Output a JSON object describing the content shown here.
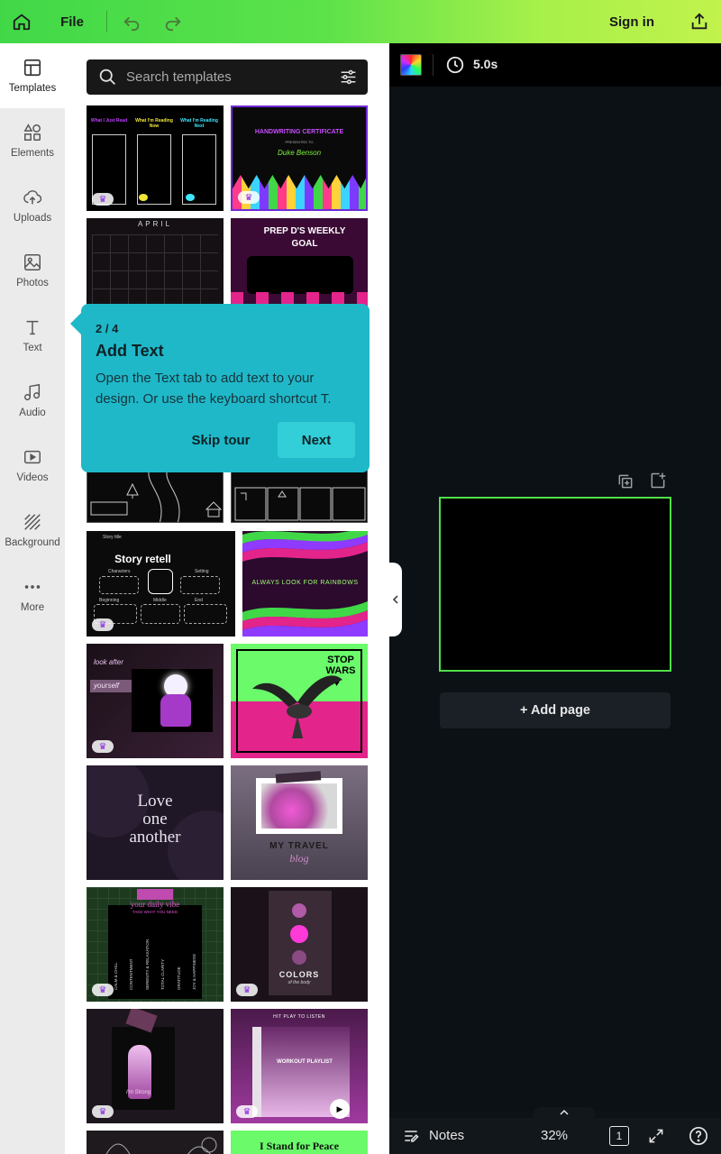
{
  "topbar": {
    "file_label": "File",
    "signin_label": "Sign in",
    "brand_gradient": [
      "#41d848",
      "#c2f24c"
    ]
  },
  "sidebar": {
    "items": [
      {
        "label": "Templates",
        "icon": "templates-icon"
      },
      {
        "label": "Elements",
        "icon": "elements-icon"
      },
      {
        "label": "Uploads",
        "icon": "uploads-icon"
      },
      {
        "label": "Photos",
        "icon": "photos-icon"
      },
      {
        "label": "Text",
        "icon": "text-icon"
      },
      {
        "label": "Audio",
        "icon": "audio-icon"
      },
      {
        "label": "Videos",
        "icon": "videos-icon"
      },
      {
        "label": "Background",
        "icon": "background-icon"
      },
      {
        "label": "More",
        "icon": "more-icon"
      }
    ]
  },
  "search": {
    "placeholder": "Search templates"
  },
  "templates": {
    "t2": {
      "title": "HANDWRITING CERTIFICATE",
      "subtitle": "PRESENTED TO",
      "name": "Duke Benson"
    },
    "t1": {
      "c1": "What I Just Read",
      "c2": "What I'm Reading Now",
      "c3": "What I'm Reading Next"
    },
    "t3": {
      "title": "APRIL"
    },
    "t4": {
      "title": "PREP D'S WEEKLY GOAL"
    },
    "t7": {
      "title": "Story retell",
      "col1": "Characters",
      "col2": "Setting",
      "col3": "Beginning",
      "col4": "Middle",
      "col5": "End",
      "col6": "Story title"
    },
    "t8": {
      "title": "ALWAYS LOOK FOR RAINBOWS"
    },
    "t9": {
      "line1": "look after",
      "line2": "yourself"
    },
    "t10": {
      "line1": "STOP",
      "line2": "WARS"
    },
    "t11": {
      "line1": "Love",
      "line2": "one",
      "line3": "another"
    },
    "t12": {
      "title": "MY TRAVEL",
      "subtitle": "blog"
    },
    "t13": {
      "title": "your daily vibe",
      "subtitle": "TAKE WHAT YOU NEED",
      "v1": "CALM & CHILL",
      "v2": "CONTENTMENT",
      "v3": "SERENITY & RELAXATION",
      "v4": "TOTAL CLARITY",
      "v5": "GRATITUDE",
      "v6": "JOY & HAPPINESS"
    },
    "t14": {
      "title": "COLORS",
      "subtitle": "of the body"
    },
    "t15": {
      "title": "I'm Strong"
    },
    "t16": {
      "title": "HIT PLAY TO LISTEN",
      "subtitle": "WORKOUT PLAYLIST"
    },
    "t18": {
      "title": "I Stand for Peace"
    }
  },
  "tour": {
    "step": "2 / 4",
    "title": "Add Text",
    "description": "Open the Text tab to add text to your design. Or use the keyboard shortcut T.",
    "skip_label": "Skip tour",
    "next_label": "Next",
    "bg_color": "#1fb8c9"
  },
  "editor": {
    "duration": "5.0s",
    "add_page_label": "+ Add page",
    "page_border_color": "#52e04a"
  },
  "bottombar": {
    "notes_label": "Notes",
    "zoom": "32%",
    "page_count": "1"
  }
}
